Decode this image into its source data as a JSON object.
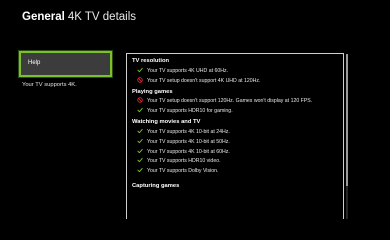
{
  "header": {
    "title": "General",
    "subtitle": "4K TV details"
  },
  "sidebar": {
    "help_label": "Help",
    "status_text": "Your TV supports 4K."
  },
  "colors": {
    "accent": "#7cc02e",
    "check": "#7cc02e",
    "error": "#e0303a"
  },
  "sections": [
    {
      "heading": "TV resolution",
      "items": [
        {
          "icon": "check-icon",
          "text": "Your TV supports 4K UHD at 60Hz."
        },
        {
          "icon": "blocked-icon",
          "text": "Your TV setup doesn't support 4K UHD at 120Hz."
        }
      ]
    },
    {
      "heading": "Playing games",
      "items": [
        {
          "icon": "blocked-icon",
          "text": "Your TV setup doesn't support 120Hz. Games won't display at 120 FPS."
        },
        {
          "icon": "check-icon",
          "text": "Your TV supports HDR10 for gaming."
        }
      ]
    },
    {
      "heading": "Watching movies and TV",
      "items": [
        {
          "icon": "check-icon",
          "text": "Your TV supports 4K 10-bit at 24Hz."
        },
        {
          "icon": "check-icon",
          "text": "Your TV supports 4K 10-bit at 50Hz."
        },
        {
          "icon": "check-icon",
          "text": "Your TV supports 4K 10-bit at 60Hz."
        },
        {
          "icon": "check-icon",
          "text": "Your TV supports HDR10 video."
        },
        {
          "icon": "check-icon",
          "text": "Your TV supports Dolby Vision."
        }
      ]
    },
    {
      "heading": "Capturing games",
      "items": []
    }
  ]
}
